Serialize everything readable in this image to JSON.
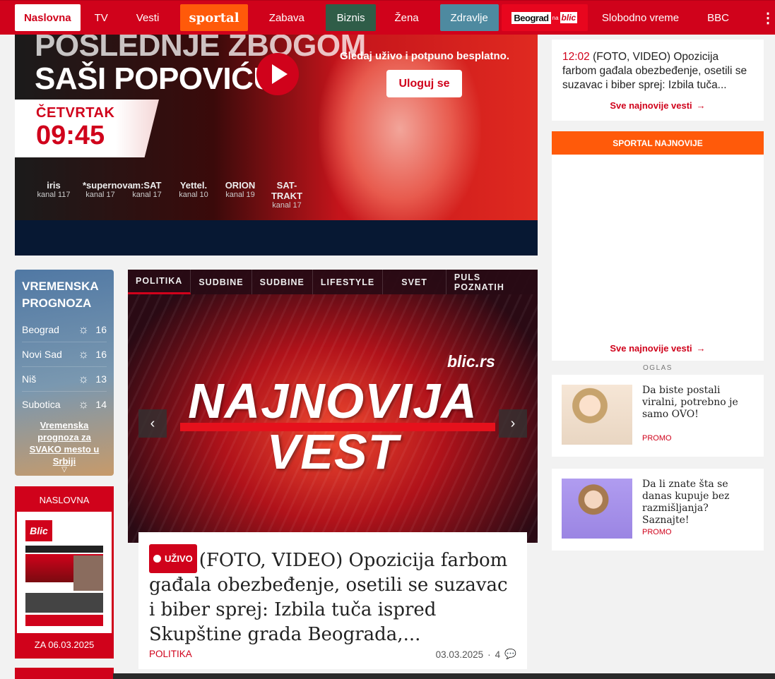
{
  "nav": {
    "items": [
      "Naslovna",
      "TV",
      "Vesti",
      "sportal",
      "Zabava",
      "Biznis",
      "Žena",
      "Zdravlje",
      "Slobodno vreme",
      "BBC"
    ],
    "beograd_logo": {
      "a": "Beograd",
      "b": "na",
      "c": "blic"
    },
    "more_icon": "⋮"
  },
  "hero": {
    "title_line1": "POSLEDNJE ZBOGOM",
    "title_line2": "SAŠI POPOVIĆU",
    "day": "ČETVRTAK",
    "time": "09:45",
    "cta": "Gledaj uživo i potpuno besplatno.",
    "login": "Uloguj se",
    "channels": [
      {
        "name": "iris",
        "kanal": "kanal 117"
      },
      {
        "name": "*supernova",
        "kanal": "kanal 17"
      },
      {
        "name": "m:SAT",
        "kanal": "kanal 17"
      },
      {
        "name": "Yettel.",
        "kanal": "kanal 10"
      },
      {
        "name": "ORION",
        "kanal": "kanal 19"
      },
      {
        "name": "SAT-TRAKT",
        "kanal": "kanal 17"
      }
    ]
  },
  "latest": {
    "time": "12:02",
    "text": "(FOTO, VIDEO) Opozicija farbom gađala obezbeđenje, osetili se suzavac i biber sprej: Izbila tuča...",
    "more": "Sve najnovije vesti"
  },
  "sportal_box": {
    "title": "SPORTAL NAJNOVIJE",
    "more": "Sve najnovije vesti"
  },
  "oglas": "OGLAS",
  "promos": [
    {
      "text": "Da biste postali viralni, potrebno je samo OVO!",
      "tag": "PROMO"
    },
    {
      "text": "Da li znate šta se danas kupuje bez razmišljanja? Saznajte!",
      "tag": "PROMO"
    }
  ],
  "weather": {
    "title": "VREMENSKA PROGNOZA",
    "rows": [
      {
        "city": "Beograd",
        "temp": "16"
      },
      {
        "city": "Novi Sad",
        "temp": "16"
      },
      {
        "city": "Niš",
        "temp": "13"
      },
      {
        "city": "Subotica",
        "temp": "14"
      }
    ],
    "link": "Vremenska prognoza za SVAKO mesto u Srbiji"
  },
  "naslovna": {
    "title": "NASLOVNA",
    "date": "ZA 06.03.2025",
    "logo": "Blic"
  },
  "story": {
    "tabs": [
      "POLITIKA",
      "SUDBINE",
      "SUDBINE",
      "LIFESTYLE",
      "SVET",
      "PULS POZNATIH"
    ],
    "brand": "blic.rs",
    "word1": "NAJNOVIJA",
    "word2": "VEST",
    "live": "UŽIVO",
    "headline": "(FOTO, VIDEO) Opozicija farbom gađala obezbeđenje, osetili se suzavac i biber sprej: Izbila tuča ispred Skupštine grada Beograda,...",
    "category": "POLITIKA",
    "date": "03.03.2025",
    "comments": "4"
  }
}
